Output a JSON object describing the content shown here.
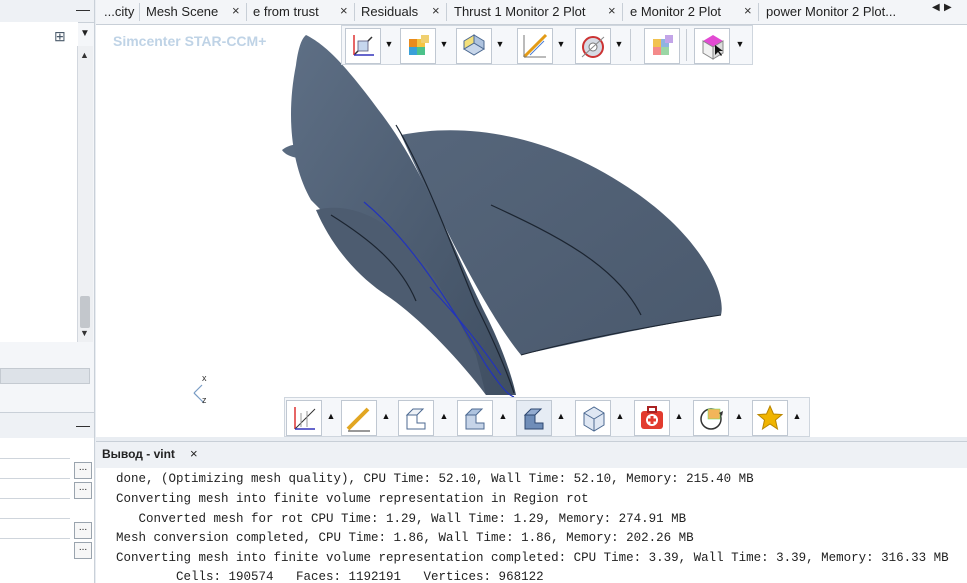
{
  "tabs": [
    {
      "label": "...city"
    },
    {
      "label": "Mesh Scene"
    },
    {
      "label": "e from trust"
    },
    {
      "label": "Residuals"
    },
    {
      "label": "Thrust 1 Monitor 2 Plot"
    },
    {
      "label": "e Monitor 2 Plot"
    },
    {
      "label": "power Monitor 2 Plot..."
    }
  ],
  "tab_close_glyph": "×",
  "viewport": {
    "watermark": "Simcenter STAR-CCM+"
  },
  "axes": {
    "x": "x",
    "z": "z"
  },
  "top_toolbar_icons": [
    "view-cube-icon",
    "color-box-icon",
    "block-yellow-icon",
    "measure-icon",
    "section-icon",
    "palette-cube-icon",
    "pink-cube-icon"
  ],
  "bottom_toolbar_icons": [
    "axis-grid-icon",
    "pencil-icon",
    "block-outline-icon",
    "block-filled-icon",
    "block-stack-icon",
    "wireframe-icon",
    "first-aid-icon",
    "refresh-camera-icon",
    "star-icon"
  ],
  "output": {
    "tab_label": "Вывод - vint",
    "lines": [
      "done, (Optimizing mesh quality), CPU Time: 52.10, Wall Time: 52.10, Memory: 215.40 MB",
      "Converting mesh into finite volume representation in Region rot",
      "   Converted mesh for rot CPU Time: 1.29, Wall Time: 1.29, Memory: 274.91 MB",
      "Mesh conversion completed, CPU Time: 1.86, Wall Time: 1.86, Memory: 202.26 MB",
      "Converting mesh into finite volume representation completed: CPU Time: 3.39, Wall Time: 3.39, Memory: 316.33 MB",
      "        Cells: 190574   Faces: 1192191   Vertices: 968122"
    ]
  },
  "left_panel": {
    "collapse_glyph": "—",
    "dots": "..."
  },
  "colors": {
    "blade": "#4c5d72",
    "curve": "#2233bb",
    "accent_star": "#f0b400",
    "aid_red": "#e23b2e"
  }
}
